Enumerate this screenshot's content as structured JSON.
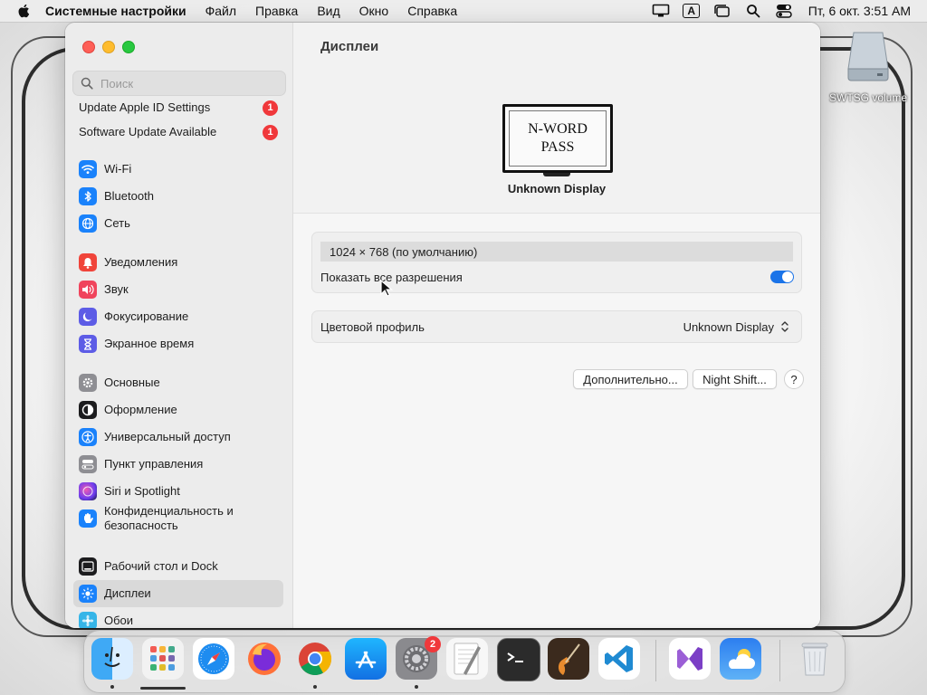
{
  "menubar": {
    "app_name": "Системные настройки",
    "items": [
      "Файл",
      "Правка",
      "Вид",
      "Окно",
      "Справка"
    ],
    "input_indicator": "A",
    "clock": "Пт, 6 окт.  3:51 AM"
  },
  "desktop": {
    "drive_label": "SWTSG volume"
  },
  "sidebar": {
    "search_placeholder": "Поиск",
    "notices": [
      {
        "label": "Update Apple ID Settings",
        "badge": "1"
      },
      {
        "label": "Software Update Available",
        "badge": "1"
      }
    ],
    "items": [
      {
        "label": "Wi-Fi",
        "icon": "wifi-icon",
        "color": "#1a82fb"
      },
      {
        "label": "Bluetooth",
        "icon": "bluetooth-icon",
        "color": "#1a82fb"
      },
      {
        "label": "Сеть",
        "icon": "globe-icon",
        "color": "#1a82fb"
      },
      {
        "label": "Уведомления",
        "icon": "bell-icon",
        "color": "#f0443a"
      },
      {
        "label": "Звук",
        "icon": "speaker-icon",
        "color": "#f0445c"
      },
      {
        "label": "Фокусирование",
        "icon": "moon-icon",
        "color": "#5d5ce6"
      },
      {
        "label": "Экранное время",
        "icon": "hourglass-icon",
        "color": "#5d5ce6"
      },
      {
        "label": "Основные",
        "icon": "gear-icon",
        "color": "#8e8e93"
      },
      {
        "label": "Оформление",
        "icon": "appearance-icon",
        "color": "#1c1c1e"
      },
      {
        "label": "Универсальный доступ",
        "icon": "accessibility-icon",
        "color": "#1a82fb"
      },
      {
        "label": "Пункт управления",
        "icon": "control-center-icon",
        "color": "#8e8e93"
      },
      {
        "label": "Siri и Spotlight",
        "icon": "siri-icon",
        "color": "#8a3ff0"
      },
      {
        "label": "Конфиденциальность и безопасность",
        "icon": "hand-icon",
        "color": "#1a82fb"
      },
      {
        "label": "Рабочий стол и Dock",
        "icon": "dock-icon",
        "color": "#1c1c1e"
      },
      {
        "label": "Дисплеи",
        "icon": "sun-icon",
        "color": "#1a82fb"
      },
      {
        "label": "Обои",
        "icon": "wallpaper-icon",
        "color": "#35b5e8"
      }
    ],
    "selected": "Дисплеи"
  },
  "main": {
    "title": "Дисплеи",
    "monitor_text_line1": "N-WORD",
    "monitor_text_line2": "PASS",
    "display_name": "Unknown Display",
    "resolution": "1024 × 768 (по умолчанию)",
    "show_all_label": "Показать все разрешения",
    "show_all_enabled": true,
    "color_profile_label": "Цветовой профиль",
    "color_profile_value": "Unknown Display",
    "advanced_button": "Дополнительно...",
    "night_shift_button": "Night Shift...",
    "help_button": "?"
  },
  "dock": {
    "apps": [
      "finder",
      "launchpad",
      "safari",
      "firefox",
      "chrome",
      "app-store",
      "system-settings",
      "textedit",
      "terminal",
      "garageband",
      "vscode",
      "visual-studio",
      "weather",
      "trash"
    ],
    "system_settings_badge": "2"
  },
  "colors": {
    "accent": "#1a73e8",
    "badge": "#f0383b"
  }
}
